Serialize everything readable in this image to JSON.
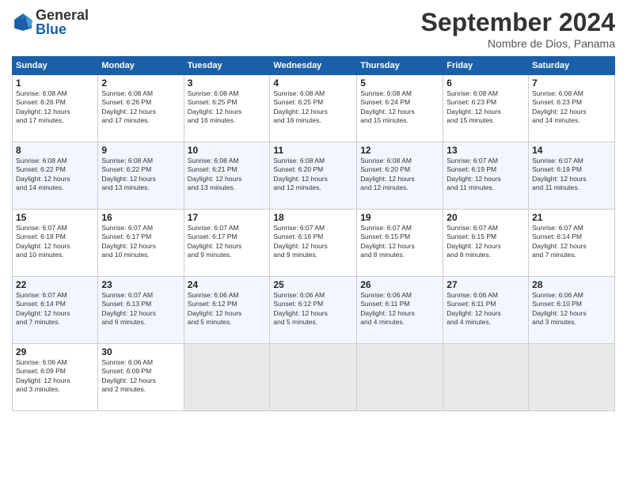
{
  "header": {
    "logo_general": "General",
    "logo_blue": "Blue",
    "month_title": "September 2024",
    "subtitle": "Nombre de Dios, Panama"
  },
  "days_of_week": [
    "Sunday",
    "Monday",
    "Tuesday",
    "Wednesday",
    "Thursday",
    "Friday",
    "Saturday"
  ],
  "weeks": [
    [
      {
        "day": "1",
        "sunrise": "6:08 AM",
        "sunset": "6:26 PM",
        "daylight": "12 hours and 17 minutes."
      },
      {
        "day": "2",
        "sunrise": "6:08 AM",
        "sunset": "6:26 PM",
        "daylight": "12 hours and 17 minutes."
      },
      {
        "day": "3",
        "sunrise": "6:08 AM",
        "sunset": "6:25 PM",
        "daylight": "12 hours and 16 minutes."
      },
      {
        "day": "4",
        "sunrise": "6:08 AM",
        "sunset": "6:25 PM",
        "daylight": "12 hours and 16 minutes."
      },
      {
        "day": "5",
        "sunrise": "6:08 AM",
        "sunset": "6:24 PM",
        "daylight": "12 hours and 15 minutes."
      },
      {
        "day": "6",
        "sunrise": "6:08 AM",
        "sunset": "6:23 PM",
        "daylight": "12 hours and 15 minutes."
      },
      {
        "day": "7",
        "sunrise": "6:08 AM",
        "sunset": "6:23 PM",
        "daylight": "12 hours and 14 minutes."
      }
    ],
    [
      {
        "day": "8",
        "sunrise": "6:08 AM",
        "sunset": "6:22 PM",
        "daylight": "12 hours and 14 minutes."
      },
      {
        "day": "9",
        "sunrise": "6:08 AM",
        "sunset": "6:22 PM",
        "daylight": "12 hours and 13 minutes."
      },
      {
        "day": "10",
        "sunrise": "6:08 AM",
        "sunset": "6:21 PM",
        "daylight": "12 hours and 13 minutes."
      },
      {
        "day": "11",
        "sunrise": "6:08 AM",
        "sunset": "6:20 PM",
        "daylight": "12 hours and 12 minutes."
      },
      {
        "day": "12",
        "sunrise": "6:08 AM",
        "sunset": "6:20 PM",
        "daylight": "12 hours and 12 minutes."
      },
      {
        "day": "13",
        "sunrise": "6:07 AM",
        "sunset": "6:19 PM",
        "daylight": "12 hours and 11 minutes."
      },
      {
        "day": "14",
        "sunrise": "6:07 AM",
        "sunset": "6:19 PM",
        "daylight": "12 hours and 11 minutes."
      }
    ],
    [
      {
        "day": "15",
        "sunrise": "6:07 AM",
        "sunset": "6:18 PM",
        "daylight": "12 hours and 10 minutes."
      },
      {
        "day": "16",
        "sunrise": "6:07 AM",
        "sunset": "6:17 PM",
        "daylight": "12 hours and 10 minutes."
      },
      {
        "day": "17",
        "sunrise": "6:07 AM",
        "sunset": "6:17 PM",
        "daylight": "12 hours and 9 minutes."
      },
      {
        "day": "18",
        "sunrise": "6:07 AM",
        "sunset": "6:16 PM",
        "daylight": "12 hours and 9 minutes."
      },
      {
        "day": "19",
        "sunrise": "6:07 AM",
        "sunset": "6:15 PM",
        "daylight": "12 hours and 8 minutes."
      },
      {
        "day": "20",
        "sunrise": "6:07 AM",
        "sunset": "6:15 PM",
        "daylight": "12 hours and 8 minutes."
      },
      {
        "day": "21",
        "sunrise": "6:07 AM",
        "sunset": "6:14 PM",
        "daylight": "12 hours and 7 minutes."
      }
    ],
    [
      {
        "day": "22",
        "sunrise": "6:07 AM",
        "sunset": "6:14 PM",
        "daylight": "12 hours and 7 minutes."
      },
      {
        "day": "23",
        "sunrise": "6:07 AM",
        "sunset": "6:13 PM",
        "daylight": "12 hours and 6 minutes."
      },
      {
        "day": "24",
        "sunrise": "6:06 AM",
        "sunset": "6:12 PM",
        "daylight": "12 hours and 5 minutes."
      },
      {
        "day": "25",
        "sunrise": "6:06 AM",
        "sunset": "6:12 PM",
        "daylight": "12 hours and 5 minutes."
      },
      {
        "day": "26",
        "sunrise": "6:06 AM",
        "sunset": "6:11 PM",
        "daylight": "12 hours and 4 minutes."
      },
      {
        "day": "27",
        "sunrise": "6:06 AM",
        "sunset": "6:11 PM",
        "daylight": "12 hours and 4 minutes."
      },
      {
        "day": "28",
        "sunrise": "6:06 AM",
        "sunset": "6:10 PM",
        "daylight": "12 hours and 3 minutes."
      }
    ],
    [
      {
        "day": "29",
        "sunrise": "6:06 AM",
        "sunset": "6:09 PM",
        "daylight": "12 hours and 3 minutes."
      },
      {
        "day": "30",
        "sunrise": "6:06 AM",
        "sunset": "6:09 PM",
        "daylight": "12 hours and 2 minutes."
      },
      null,
      null,
      null,
      null,
      null
    ]
  ]
}
